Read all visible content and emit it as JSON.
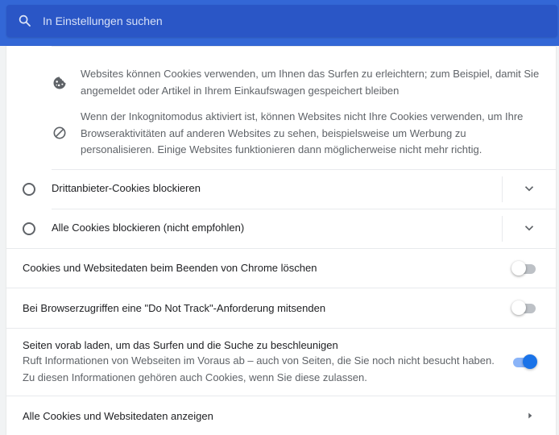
{
  "search": {
    "placeholder": "In Einstellungen suchen"
  },
  "info": {
    "cookies_text_1": "Websites können Cookies verwenden, um Ihnen das Surfen zu erleichtern; zum Beispiel, damit Sie",
    "cookies_text_2": "angemeldet oder Artikel in Ihrem Einkaufswagen gespeichert bleiben",
    "incognito_text_1": "Wenn der Inkognitomodus aktiviert ist, können Websites nicht Ihre Cookies verwenden, um Ihre",
    "incognito_text_2": "Browseraktivitäten auf anderen Websites zu sehen, beispielsweise um Werbung zu",
    "incognito_text_3": "personalisieren. Einige Websites funktionieren dann möglicherweise nicht mehr richtig.",
    "icons": [
      "cookie-icon",
      "block-icon"
    ]
  },
  "radio_options": [
    {
      "label": "Drittanbieter-Cookies blockieren",
      "selected": false
    },
    {
      "label": "Alle Cookies blockieren (nicht empfohlen)",
      "selected": false
    }
  ],
  "settings": {
    "clear_on_exit": {
      "label": "Cookies und Websitedaten beim Beenden von Chrome löschen",
      "enabled": false
    },
    "do_not_track": {
      "label": "Bei Browserzugriffen eine \"Do Not Track\"-Anforderung mitsenden",
      "enabled": false
    },
    "preload": {
      "label": "Seiten vorab laden, um das Surfen und die Suche zu beschleunigen",
      "sub_1": "Ruft Informationen von Webseiten im Voraus ab – auch von Seiten, die Sie noch nicht besucht haben.",
      "sub_2": "Zu diesen Informationen gehören auch Cookies, wenn Sie diese zulassen.",
      "enabled": true
    },
    "all_cookies": {
      "label": "Alle Cookies und Websitedaten anzeigen"
    }
  },
  "colors": {
    "header": "#3367d6",
    "search_bg": "#2a56c6",
    "accent": "#1a73e8",
    "toggle_off": "#bdc1c6"
  }
}
